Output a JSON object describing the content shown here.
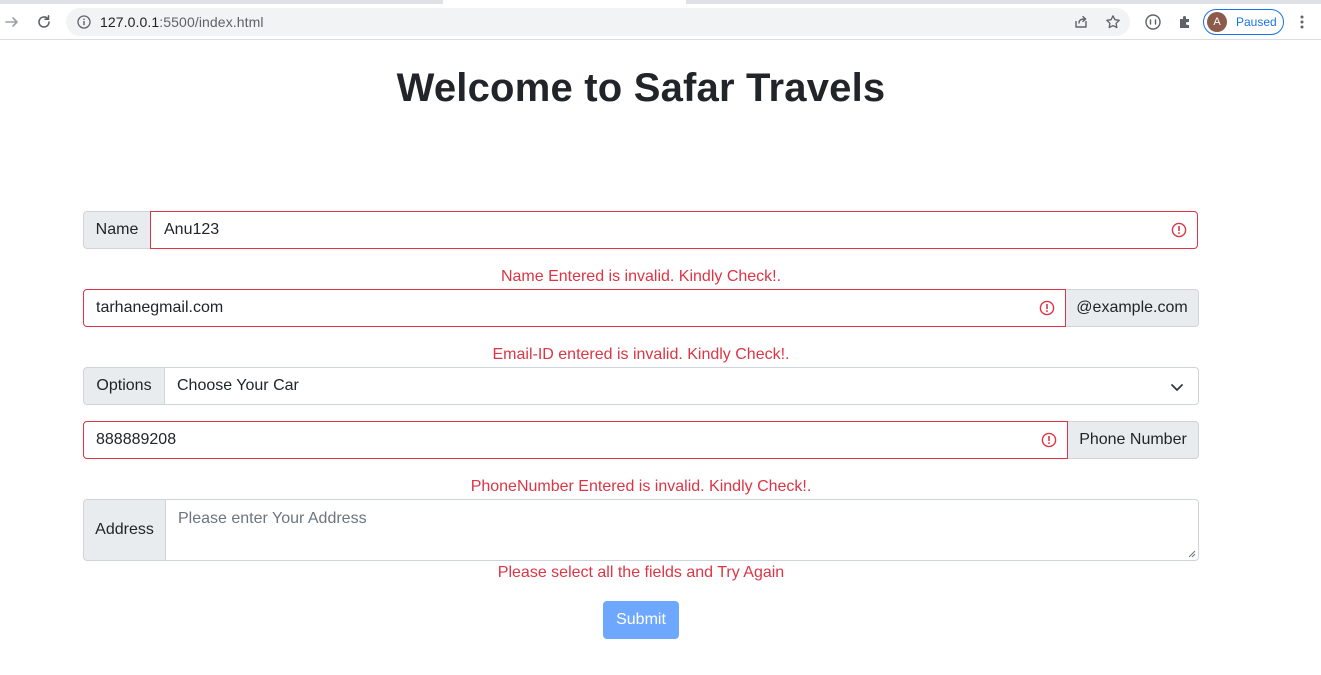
{
  "browser": {
    "url_host": "127.0.0.1",
    "url_path": ":5500/index.html",
    "profile_initial": "A",
    "profile_status": "Paused"
  },
  "page": {
    "title": "Welcome to Safar Travels"
  },
  "form": {
    "name": {
      "label": "Name",
      "value": "Anu123",
      "error": "Name Entered is invalid. Kindly Check!."
    },
    "email": {
      "value": "tarhanegmail.com",
      "suffix": "@example.com",
      "error": "Email-ID entered is invalid. Kindly Check!."
    },
    "car": {
      "label": "Options",
      "selected": "Choose Your Car"
    },
    "phone": {
      "value": "888889208",
      "suffix": "Phone Number",
      "error": "PhoneNumber Entered is invalid. Kindly Check!."
    },
    "address": {
      "label": "Address",
      "placeholder": "Please enter Your Address"
    },
    "general_error": "Please select all the fields and Try Again",
    "submit_label": "Submit"
  },
  "colors": {
    "invalid": "#dc3545",
    "submit": "#6ea8fe",
    "addon_bg": "#e9ecef"
  }
}
